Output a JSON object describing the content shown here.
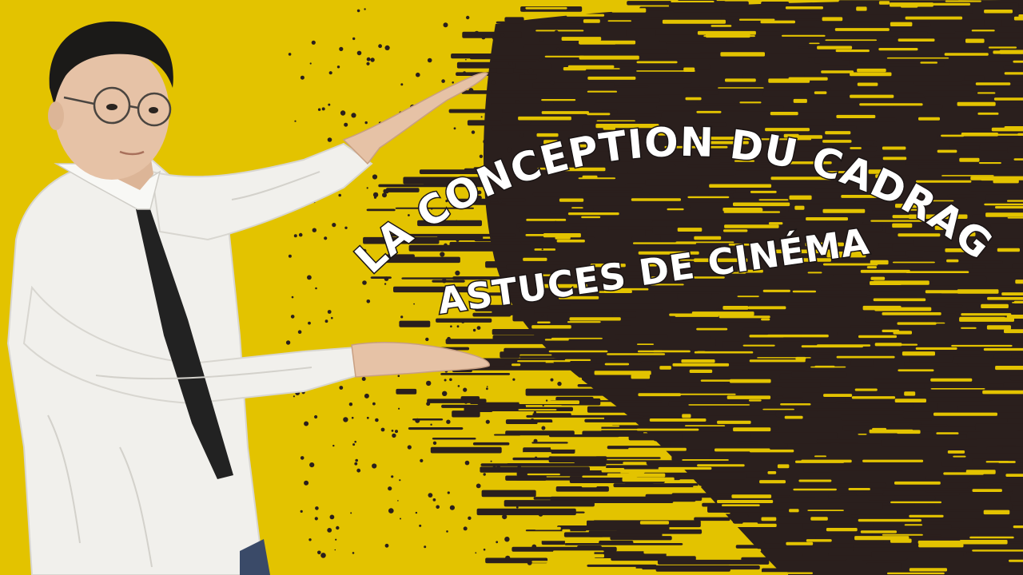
{
  "thumbnail": {
    "title_line1": "LA CONCEPTION DU CADRAGE",
    "title_line2": "ASTUCES DE CINÉMA",
    "colors": {
      "background": "#e3c300",
      "brush": "#2a1f1d",
      "title_fill": "#ffffff",
      "title_outline": "#1a1414",
      "shirt": "#f1f0ec",
      "tie": "#222222",
      "skin": "#e6c2a6",
      "hair": "#1b1a18"
    },
    "icons": {
      "subject": "person-framing-gesture-photo",
      "texture": "grunge-brush-texture"
    }
  }
}
